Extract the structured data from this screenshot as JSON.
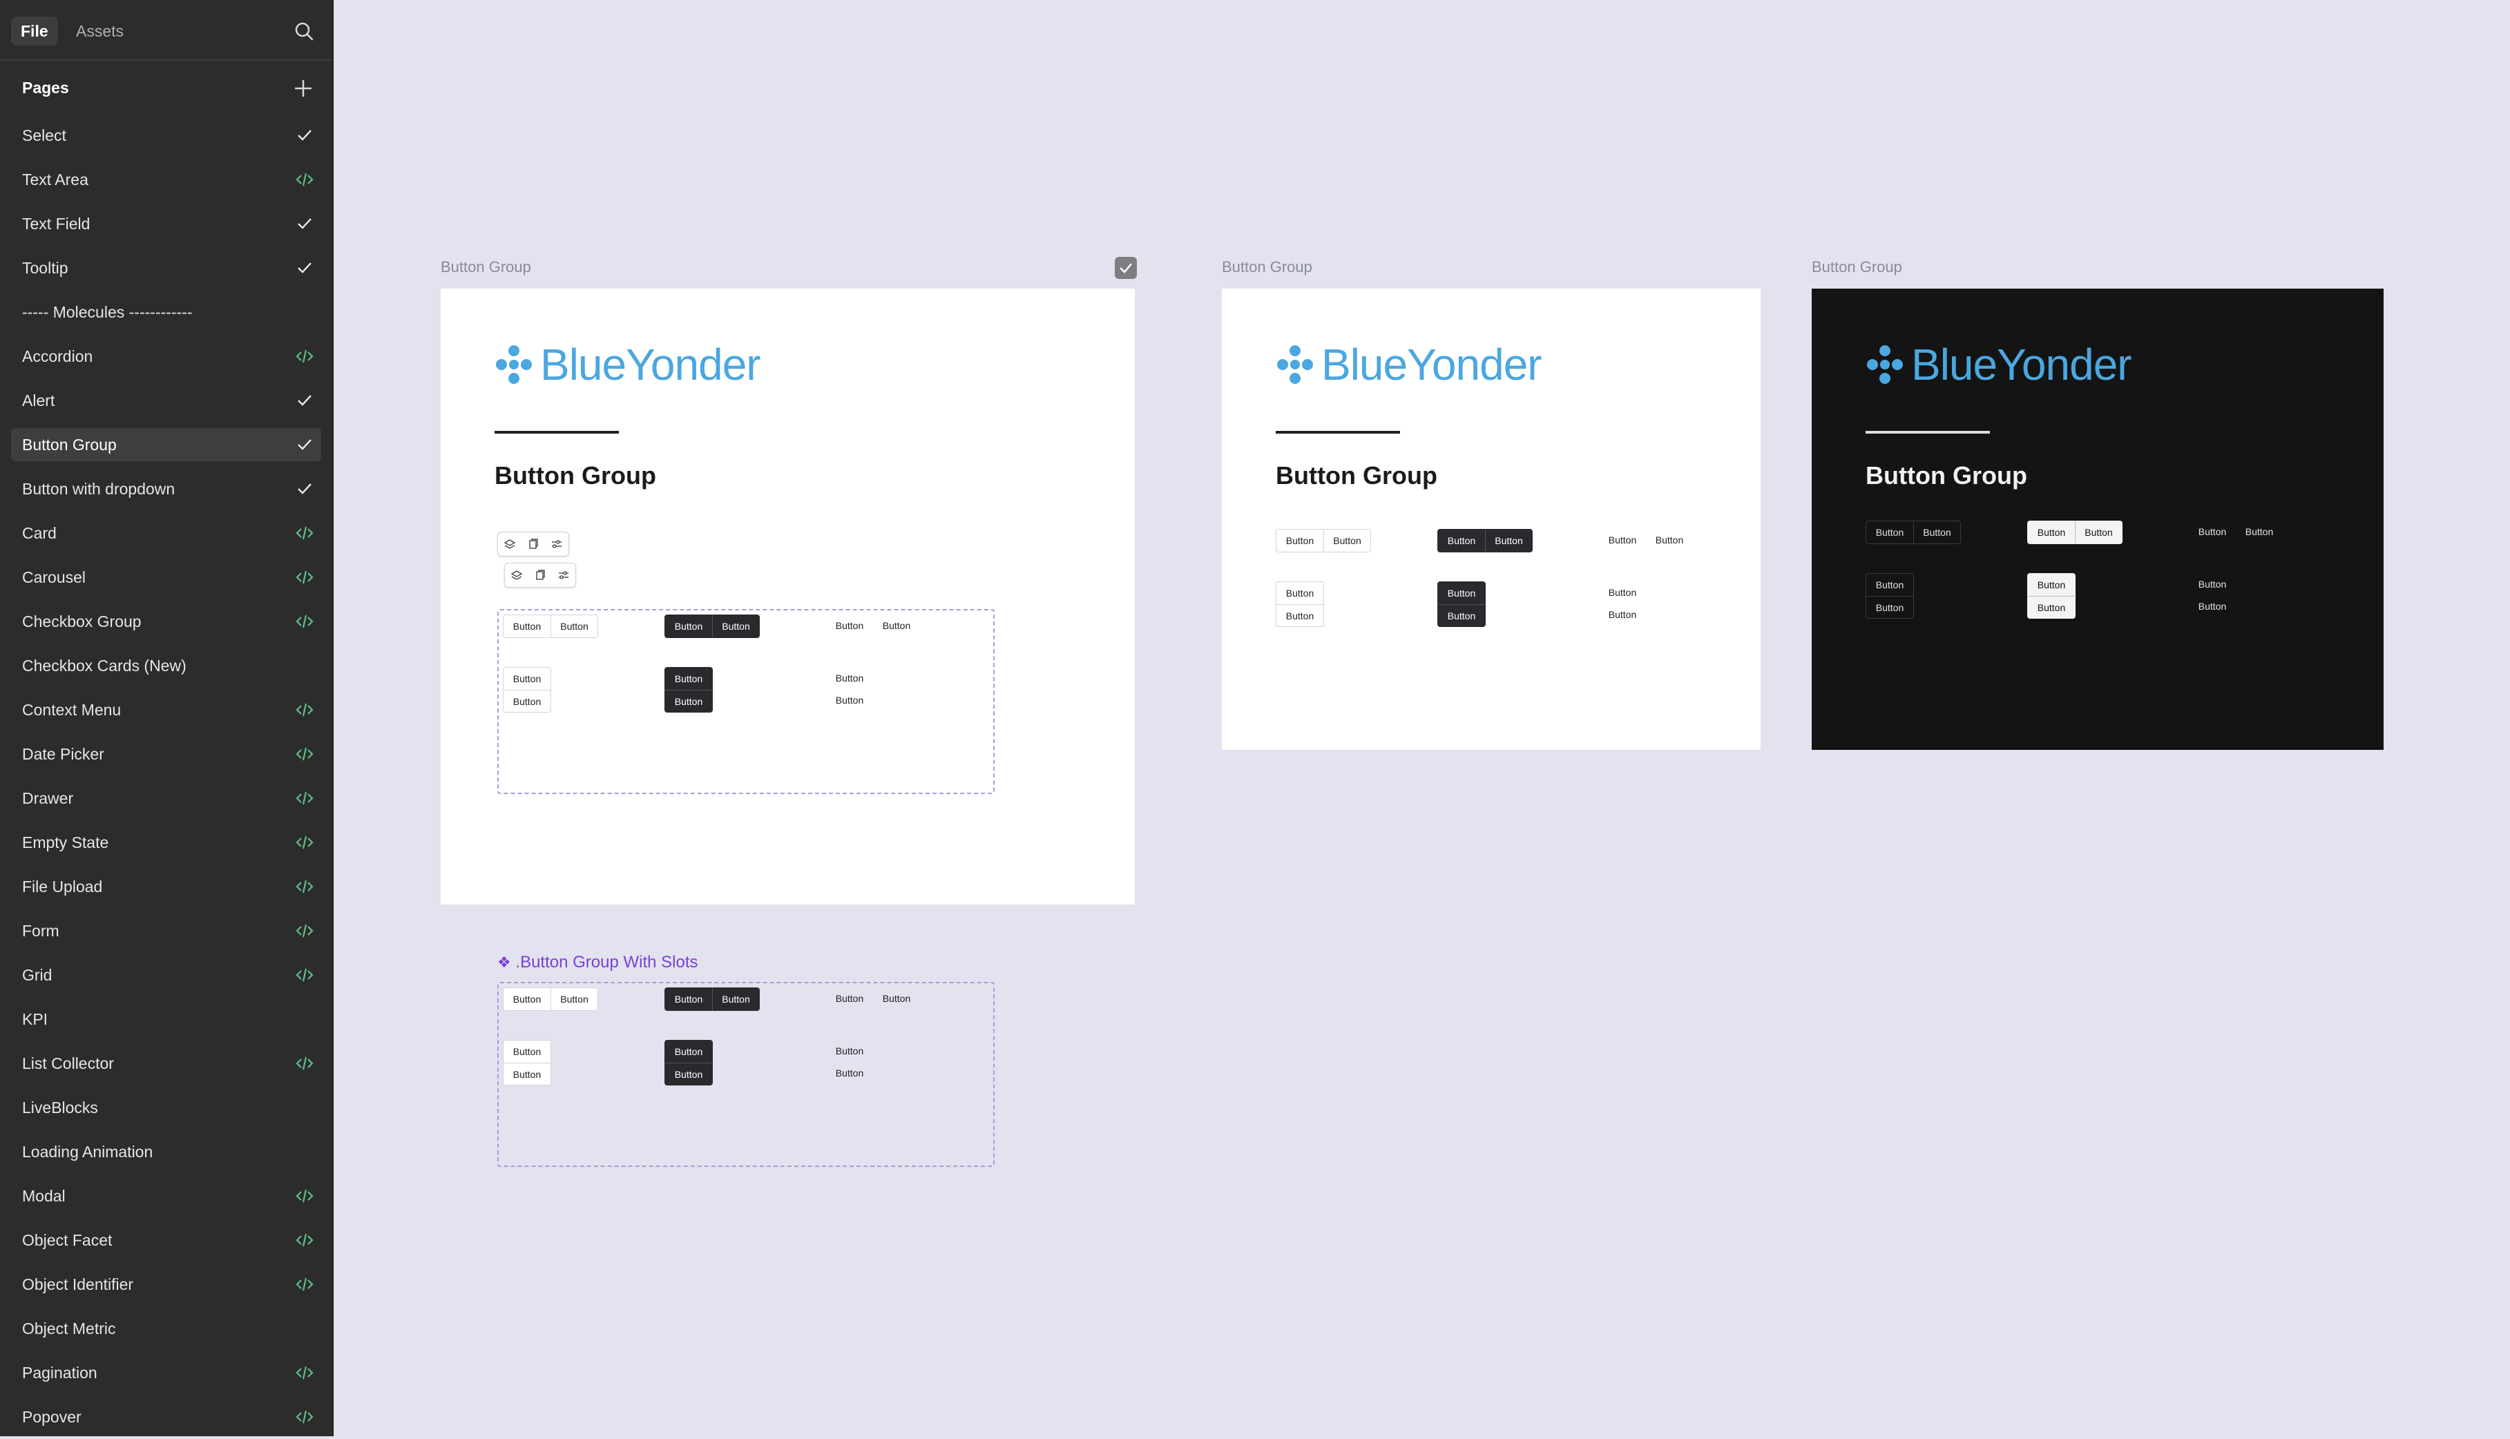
{
  "sidebar": {
    "tabs": {
      "file": "File",
      "assets": "Assets"
    },
    "pages_title": "Pages",
    "items": [
      {
        "label": "Select",
        "icon": "check-icon"
      },
      {
        "label": "Text Area",
        "icon": "code-icon"
      },
      {
        "label": "Text Field",
        "icon": "check-icon"
      },
      {
        "label": "Tooltip",
        "icon": "check-icon"
      },
      {
        "label": "----- Molecules ------------",
        "icon": ""
      },
      {
        "label": "Accordion",
        "icon": "code-icon"
      },
      {
        "label": "Alert",
        "icon": "check-icon"
      },
      {
        "label": "Button Group",
        "icon": "check-icon",
        "active": true
      },
      {
        "label": "Button with dropdown",
        "icon": "check-icon"
      },
      {
        "label": "Card",
        "icon": "code-icon"
      },
      {
        "label": "Carousel",
        "icon": "code-icon"
      },
      {
        "label": "Checkbox Group",
        "icon": "code-icon"
      },
      {
        "label": "Checkbox Cards (New)",
        "icon": ""
      },
      {
        "label": "Context Menu",
        "icon": "code-icon"
      },
      {
        "label": "Date Picker",
        "icon": "code-icon"
      },
      {
        "label": "Drawer",
        "icon": "code-icon"
      },
      {
        "label": "Empty State",
        "icon": "code-icon"
      },
      {
        "label": "File Upload",
        "icon": "code-icon"
      },
      {
        "label": "Form",
        "icon": "code-icon"
      },
      {
        "label": "Grid",
        "icon": "code-icon"
      },
      {
        "label": "KPI",
        "icon": ""
      },
      {
        "label": "List Collector",
        "icon": "code-icon"
      },
      {
        "label": "LiveBlocks",
        "icon": ""
      },
      {
        "label": "Loading Animation",
        "icon": ""
      },
      {
        "label": "Modal",
        "icon": "code-icon"
      },
      {
        "label": "Object Facet",
        "icon": "code-icon"
      },
      {
        "label": "Object Identifier",
        "icon": "code-icon"
      },
      {
        "label": "Object Metric",
        "icon": ""
      },
      {
        "label": "Pagination",
        "icon": "code-icon"
      },
      {
        "label": "Popover",
        "icon": "code-icon"
      }
    ]
  },
  "canvas": {
    "frame_label": "Button Group",
    "brand": "BlueYonder",
    "title": "Button Group",
    "button_text": "Button",
    "component_label": ".Button Group With Slots"
  },
  "colors": {
    "sidebar_bg": "#2c2c2c",
    "canvas_bg": "#e2e3ee",
    "brand_blue": "#4aa7e0",
    "code_icon_green": "#5fc08a",
    "component_purple": "#7b3fd6"
  }
}
